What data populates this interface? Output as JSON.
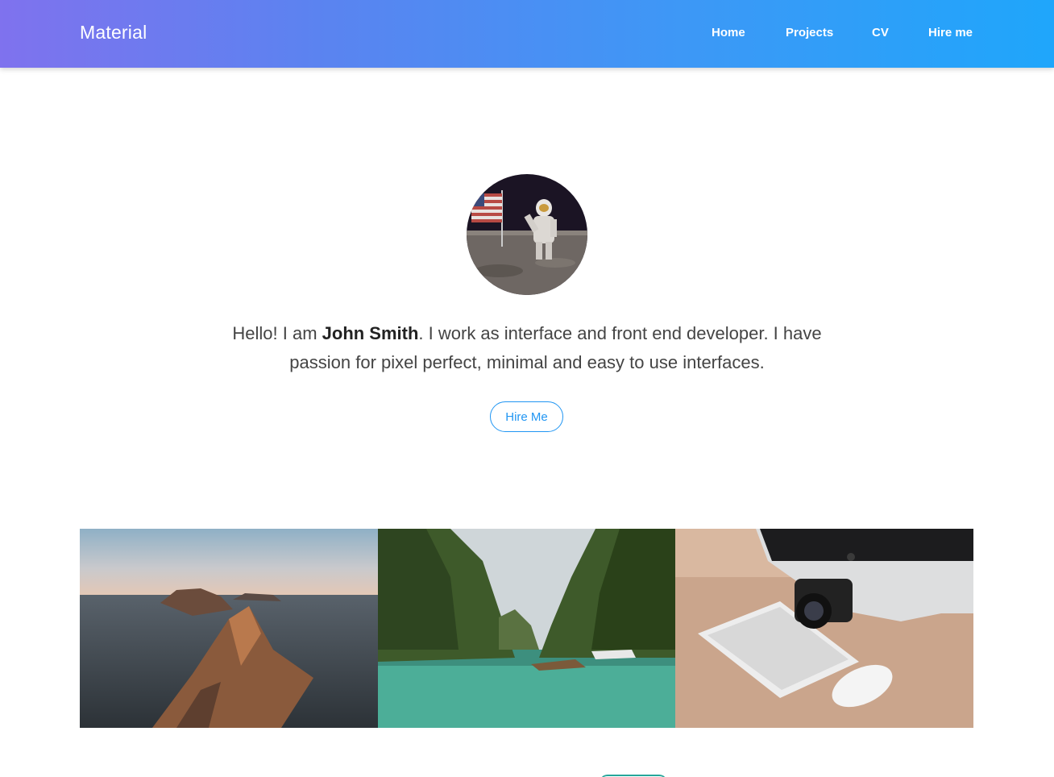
{
  "navbar": {
    "brand": "Material",
    "links": [
      {
        "label": "Home"
      },
      {
        "label": "Projects"
      },
      {
        "label": "CV"
      },
      {
        "label": "Hire me"
      }
    ],
    "gradient": [
      "#7f72ee",
      "#1fa6fb"
    ]
  },
  "hero": {
    "intro_before": "Hello! I am ",
    "name": "John Smith",
    "intro_after": ". I work as interface and front end developer. I have passion for pixel perfect, minimal and easy to use interfaces.",
    "button": "Hire Me",
    "accent": "#2196f3"
  },
  "gallery": {
    "images": [
      "sea-cliffs-photo",
      "tropical-lagoon-photo",
      "desk-keyboard-camera-photo"
    ]
  }
}
